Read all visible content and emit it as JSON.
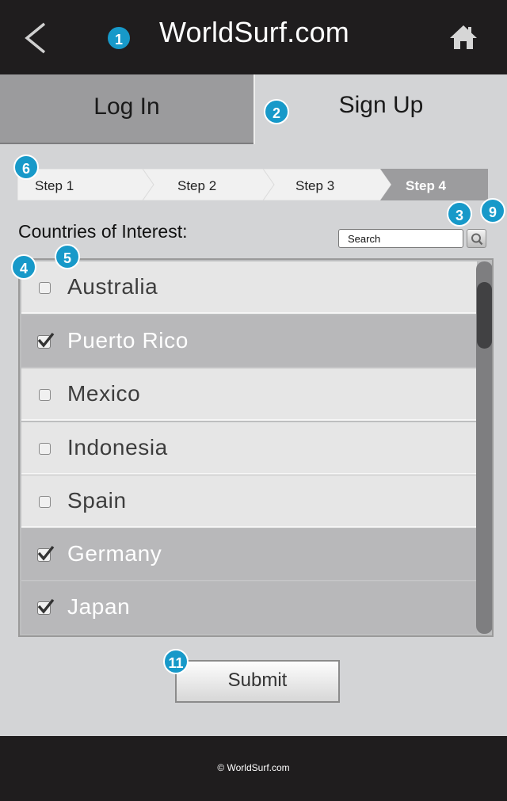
{
  "header": {
    "title": "WorldSurf.com"
  },
  "tabs": [
    {
      "label": "Log In",
      "active": false
    },
    {
      "label": "Sign Up",
      "active": true
    }
  ],
  "steps": [
    {
      "label": "Step 1",
      "active": false
    },
    {
      "label": "Step 2",
      "active": false
    },
    {
      "label": "Step 3",
      "active": false
    },
    {
      "label": "Step 4",
      "active": true
    }
  ],
  "countries": {
    "label": "Countries of Interest:",
    "search_placeholder": "Search",
    "items": [
      {
        "name": "Australia",
        "checked": false
      },
      {
        "name": "Puerto Rico",
        "checked": true
      },
      {
        "name": "Mexico",
        "checked": false
      },
      {
        "name": "Indonesia",
        "checked": false
      },
      {
        "name": "Spain",
        "checked": false
      },
      {
        "name": "Germany",
        "checked": true
      },
      {
        "name": "Japan",
        "checked": true
      }
    ]
  },
  "submit_label": "Submit",
  "footer": {
    "copyright": "© WorldSurf.com"
  },
  "markers": [
    "1",
    "2",
    "3",
    "4",
    "5",
    "6",
    "9",
    "11"
  ],
  "colors": {
    "accent": "#1799c9",
    "header_bg": "#1f1d1e",
    "page_bg": "#d3d4d6"
  }
}
